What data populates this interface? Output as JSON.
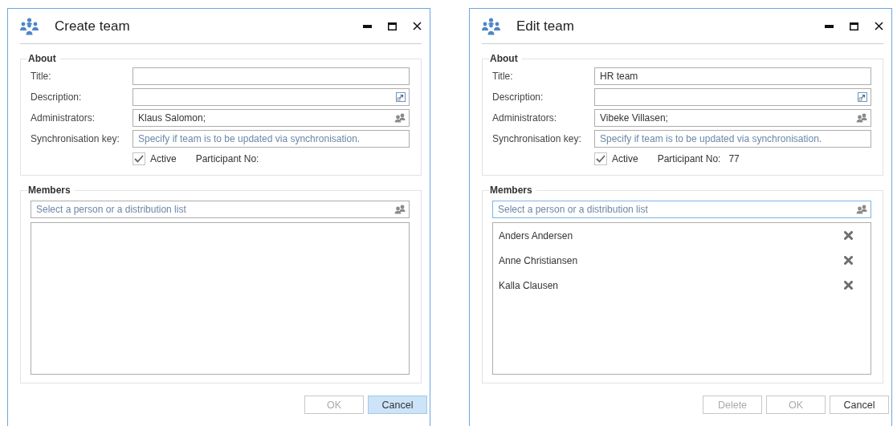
{
  "dialogs": [
    {
      "title": "Create team",
      "about": {
        "legend": "About",
        "fields": [
          {
            "label": "Title:",
            "kind": "text"
          },
          {
            "label": "Description:",
            "kind": "expand"
          },
          {
            "label": "Administrators:",
            "kind": "people",
            "value": "Klaus Salomon;"
          },
          {
            "label": "Synchronisation key:",
            "kind": "text",
            "placeholder": "Specify if team is to be updated via synchronisation."
          }
        ],
        "active": {
          "label": "Active",
          "checked": true
        },
        "participant": {
          "label": "Participant No:"
        }
      },
      "members": {
        "legend": "Members",
        "search": {
          "placeholder": "Select a person or a distribution list",
          "focused": false
        }
      },
      "buttons": [
        {
          "label": "OK",
          "disabled": true,
          "highlighted": false
        },
        {
          "label": "Cancel",
          "disabled": false,
          "highlighted": true
        }
      ]
    },
    {
      "title": "Edit team",
      "about": {
        "legend": "About",
        "fields": [
          {
            "label": "Title:",
            "kind": "text",
            "value": "HR team"
          },
          {
            "label": "Description:",
            "kind": "expand"
          },
          {
            "label": "Administrators:",
            "kind": "people",
            "value": "Vibeke Villasen;"
          },
          {
            "label": "Synchronisation key:",
            "kind": "text",
            "placeholder": "Specify if team is to be updated via synchronisation."
          }
        ],
        "active": {
          "label": "Active",
          "checked": true
        },
        "participant": {
          "label": "Participant No:",
          "value": "77"
        }
      },
      "members": {
        "legend": "Members",
        "search": {
          "placeholder": "Select a person or a distribution list",
          "focused": true
        },
        "items": [
          {
            "name": "Anders Andersen"
          },
          {
            "name": "Anne Christiansen"
          },
          {
            "name": "Kalla Clausen"
          }
        ]
      },
      "buttons": [
        {
          "label": "Delete",
          "disabled": true,
          "highlighted": false
        },
        {
          "label": "OK",
          "disabled": true,
          "highlighted": false
        },
        {
          "label": "Cancel",
          "disabled": false,
          "highlighted": false
        }
      ]
    }
  ]
}
